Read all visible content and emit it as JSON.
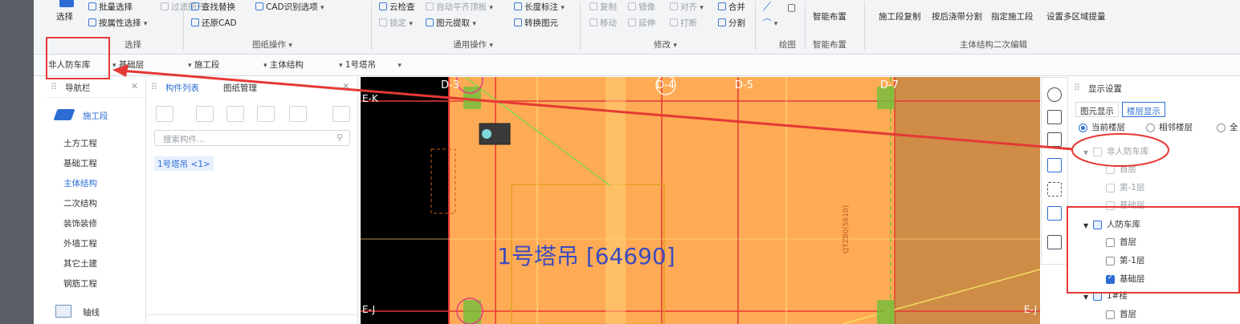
{
  "ribbon": {
    "select_label": "选择",
    "batch_select": "批量选择",
    "filter_elements": "过滤图元",
    "attr_select": "按属性选择",
    "find_replace": "查找替换",
    "cad_options": "CAD识别选项",
    "restore_cad": "还原CAD",
    "cloud_check": "云检查",
    "auto_flush_top": "自动平齐顶板",
    "length_mark": "长度标注",
    "lock": "锁定",
    "extract_element": "图元提取",
    "convert_element": "转换图元",
    "copy": "复制",
    "mirror": "镜像",
    "align": "对齐",
    "merge": "合并",
    "move": "移动",
    "extend": "延伸",
    "break": "打断",
    "split": "分割",
    "smart_layout": "智能布置",
    "stage_copy": "施工段复制",
    "split_by_pour_strip": "按后浇带分割",
    "assign_stage": "指定施工段",
    "multi_area_qty": "设置多区域提量",
    "groups": {
      "select": "选择",
      "drawing_ops": "图纸操作",
      "general_ops": "通用操作",
      "modify": "修改",
      "draw": "绘图",
      "smart_layout": "智能布置",
      "secondary_edit": "主体结构二次编辑"
    }
  },
  "filters": {
    "floor": "非人防车库",
    "level": "基础层",
    "segment": "施工段",
    "category": "主体结构",
    "element": "1号塔吊"
  },
  "nav": {
    "title": "导航栏",
    "top_item": "施工段",
    "items": [
      "土方工程",
      "基础工程",
      "主体结构",
      "二次结构",
      "装饰装修",
      "外墙工程",
      "其它土建",
      "钢筋工程"
    ],
    "active_index": 2,
    "axis_label": "轴线"
  },
  "components": {
    "tab_list": "构件列表",
    "tab_drawings": "图纸管理",
    "search_placeholder": "搜索构件...",
    "item": "1号塔吊 <1>"
  },
  "canvas": {
    "main_label": "1号塔吊 [64690]",
    "axis_top": [
      "D-3",
      "D-4",
      "D-5",
      "D-7"
    ],
    "axis_left": [
      "E-K",
      "E-J"
    ],
    "axis_right": "E-J",
    "vertical_text": "QTZ80(5610)"
  },
  "display": {
    "title": "显示设置",
    "tab_element": "图元显示",
    "tab_floor": "楼层显示",
    "radio_current": "当前楼层",
    "radio_adjacent": "相邻楼层",
    "radio_all": "全",
    "group1": "非人防车库",
    "group1_items": [
      "首层",
      "第-1层",
      "基础层"
    ],
    "group2": "人防车库",
    "group2_items": [
      "首层",
      "第-1层",
      "基础层"
    ],
    "group3": "1#楼",
    "group3_items": [
      "首层"
    ]
  },
  "colors": {
    "accent": "#2d6dd3",
    "canvas_fill": "#ffab55",
    "highlight": "#e53935"
  }
}
